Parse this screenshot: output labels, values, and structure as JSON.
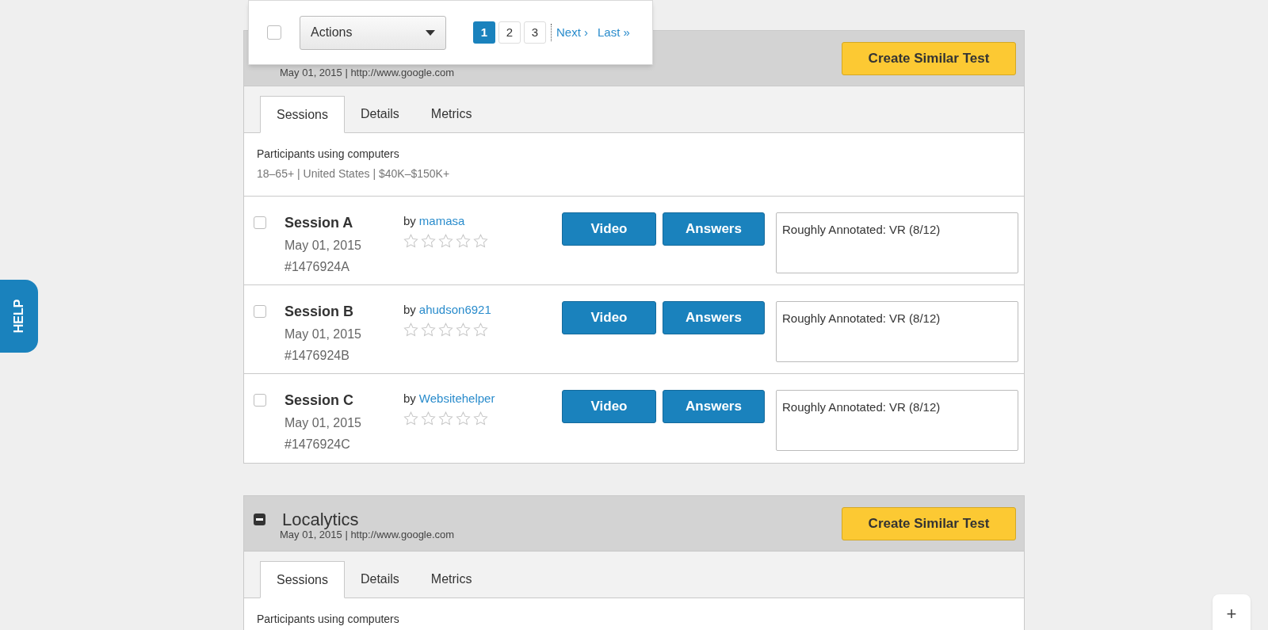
{
  "toolbar": {
    "select_all": {
      "checked": false
    },
    "actions": {
      "label": "Actions"
    },
    "pages": [
      {
        "label": "1",
        "selected": true
      },
      {
        "label": "2",
        "selected": false
      },
      {
        "label": "3",
        "selected": false
      }
    ],
    "links": [
      "Next ›",
      "Last »"
    ]
  },
  "help_tab": "HELP",
  "tests": [
    {
      "subtitle": "May 01, 2015 | http://www.google.com",
      "button": "Create Similar Test",
      "tabs": [
        {
          "label": "Sessions",
          "selected": true
        },
        {
          "label": "Details",
          "selected": false
        },
        {
          "label": "Metrics",
          "selected": false
        }
      ],
      "audience": "Participants using computers",
      "demographics": "18–65+ | United States | $40K–$150K+",
      "sessions": [
        {
          "title": "Session A",
          "date": "May 01, 2015",
          "id": "#1476924A",
          "by": "by",
          "user": "mamasa",
          "stars": 0,
          "checked": false,
          "video": "Video",
          "answers": "Answers",
          "note": "Roughly Annotated: VR (8/12)"
        },
        {
          "title": "Session B",
          "date": "May 01, 2015",
          "id": "#1476924B",
          "by": "by",
          "user": "ahudson6921",
          "stars": 0,
          "checked": false,
          "video": "Video",
          "answers": "Answers",
          "note": "Roughly Annotated: VR (8/12)"
        },
        {
          "title": "Session C",
          "date": "May 01, 2015",
          "id": "#1476924C",
          "by": "by",
          "user": "Websitehelper",
          "stars": 0,
          "checked": false,
          "video": "Video",
          "answers": "Answers",
          "note": "Roughly Annotated: VR (8/12)"
        }
      ]
    },
    {
      "title": "Localytics",
      "expanded": true,
      "subtitle": "May 01, 2015 | http://www.google.com",
      "button": "Create Similar Test",
      "tabs": [
        {
          "label": "Sessions",
          "selected": true
        },
        {
          "label": "Details",
          "selected": false
        },
        {
          "label": "Metrics",
          "selected": false
        }
      ],
      "audience": "Participants using computers"
    }
  ],
  "add_button": "+"
}
